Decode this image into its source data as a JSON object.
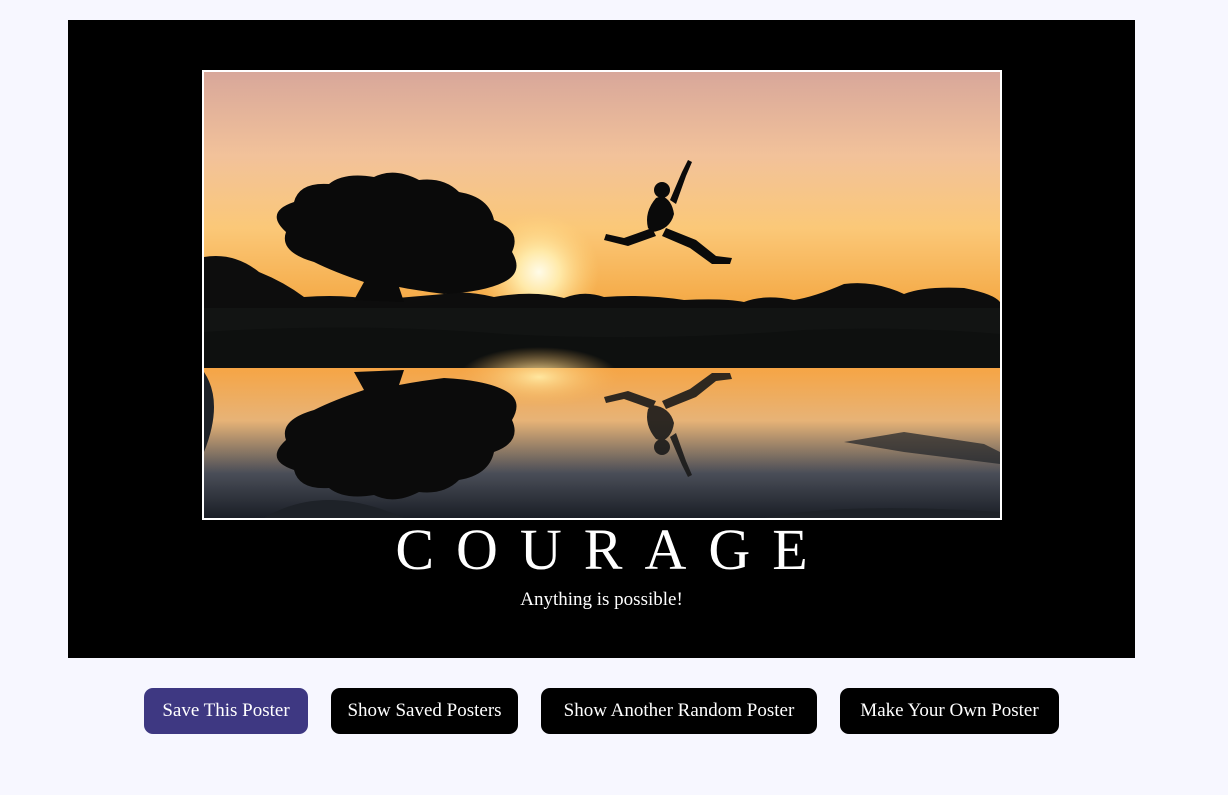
{
  "poster": {
    "title": "COURAGE",
    "quote": "Anything is possible!",
    "image_subject": "silhouette of person jumping over a reflective puddle at sunset beside a tree"
  },
  "buttons": {
    "save": "Save This Poster",
    "show_saved": "Show Saved Posters",
    "random": "Show Another Random Poster",
    "make_own": "Make Your Own Poster"
  },
  "colors": {
    "page_background": "#f7f7ff",
    "poster_background": "#000000",
    "primary_button": "#3e3882",
    "secondary_button": "#000000",
    "text": "#ffffff"
  }
}
